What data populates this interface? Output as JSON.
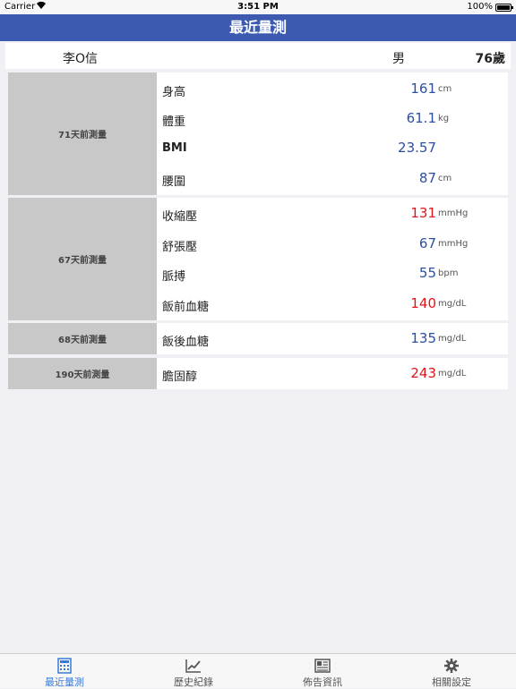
{
  "status_bar": {
    "carrier": "Carrier",
    "time": "3:51 PM",
    "battery": "100%"
  },
  "nav": {
    "title": "最近量測"
  },
  "patient": {
    "name": "李O信",
    "gender": "男",
    "age": "76歲"
  },
  "groups": [
    {
      "label": "71天前測量",
      "items": [
        {
          "name": "身高",
          "value": "161",
          "unit": "cm",
          "alert": false
        },
        {
          "name": "體重",
          "value": "61.1",
          "unit": "kg",
          "alert": false
        },
        {
          "name": "BMI",
          "value": "23.57",
          "unit": "",
          "alert": false
        },
        {
          "name": "腰圍",
          "value": "87",
          "unit": "cm",
          "alert": false
        }
      ]
    },
    {
      "label": "67天前測量",
      "items": [
        {
          "name": "收縮壓",
          "value": "131",
          "unit": "mmHg",
          "alert": true
        },
        {
          "name": "舒張壓",
          "value": "67",
          "unit": "mmHg",
          "alert": false
        },
        {
          "name": "脈搏",
          "value": "55",
          "unit": "bpm",
          "alert": false
        },
        {
          "name": "飯前血糖",
          "value": "140",
          "unit": "mg/dL",
          "alert": true
        }
      ]
    },
    {
      "label": "68天前測量",
      "items": [
        {
          "name": "飯後血糖",
          "value": "135",
          "unit": "mg/dL",
          "alert": false
        }
      ]
    },
    {
      "label": "190天前測量",
      "items": [
        {
          "name": "膽固醇",
          "value": "243",
          "unit": "mg/dL",
          "alert": true
        }
      ]
    }
  ],
  "tabs": [
    {
      "label": "最近量測",
      "icon": "calculator-icon",
      "active": true
    },
    {
      "label": "歷史紀錄",
      "icon": "trend-chart-icon",
      "active": false
    },
    {
      "label": "佈告資訊",
      "icon": "newspaper-icon",
      "active": false
    },
    {
      "label": "相關設定",
      "icon": "gear-icon",
      "active": false
    }
  ],
  "colors": {
    "nav_bg": "#3b5ab0",
    "value_blue": "#2a4fa3",
    "value_alert": "#e0141b",
    "tab_active": "#3a7bd5"
  }
}
